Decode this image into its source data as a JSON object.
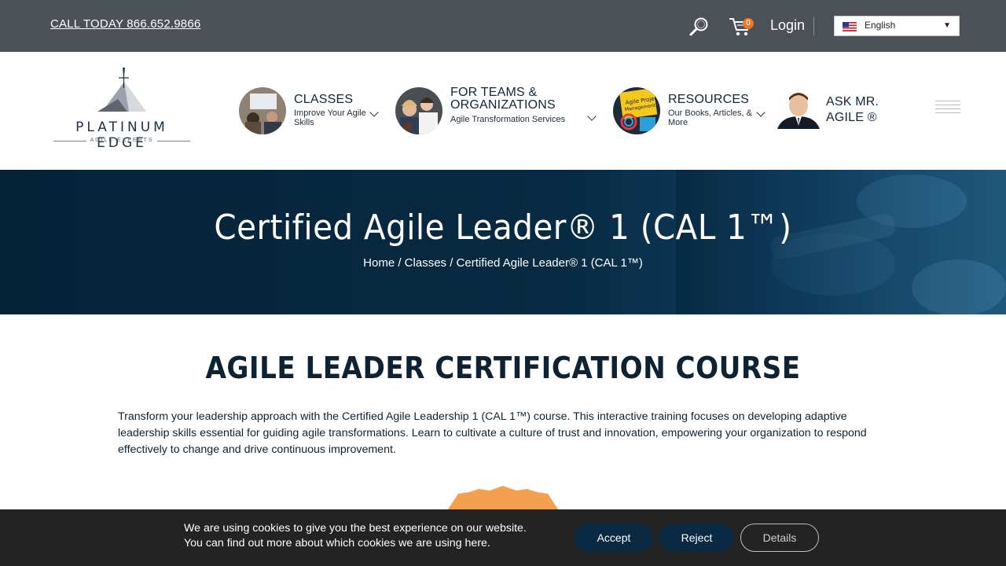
{
  "topbar": {
    "call_text": "CALL TODAY 866.652.9866",
    "cart_count": "0",
    "login_label": "Login",
    "language": "English"
  },
  "nav": {
    "logo": {
      "name": "PLATINUM EDGE",
      "tagline": "AGILE EXPERTS"
    },
    "items": [
      {
        "title": "CLASSES",
        "subtitle": "Improve Your Agile Skills"
      },
      {
        "title": "FOR TEAMS & ORGANIZATIONS",
        "subtitle": "Agile Transformation Services"
      },
      {
        "title": "RESOURCES",
        "subtitle": "Our Books, Articles, & More"
      },
      {
        "title": "ASK MR. AGILE ®"
      }
    ]
  },
  "hero": {
    "title": "Certified Agile Leader® 1 (CAL 1™)",
    "breadcrumb": "Home / Classes / Certified Agile Leader® 1 (CAL 1™)"
  },
  "main": {
    "heading": "AGILE LEADER CERTIFICATION COURSE",
    "intro": "Transform your leadership approach with the Certified Agile Leadership 1 (CAL 1™) course. This interactive training focuses on developing adaptive leadership skills essential for guiding agile transformations. Learn to cultivate a culture of trust and innovation, empowering your organization to respond effectively to change and drive continuous improvement."
  },
  "cookie": {
    "line1": "We are using cookies to give you the best experience on our website.",
    "line2": "You can find out more about which cookies we are using here.",
    "accept_label": "Accept",
    "reject_label": "Reject",
    "details_label": "Details"
  },
  "colors": {
    "topbar": "#4b5157",
    "hero": "#062338",
    "cookie_bar": "#232323",
    "button": "#0a2a44",
    "accent": "#e9782d"
  },
  "icons": [
    "search-icon",
    "cart-icon",
    "flag-us-icon",
    "chevron-down-icon",
    "hamburger-icon"
  ]
}
